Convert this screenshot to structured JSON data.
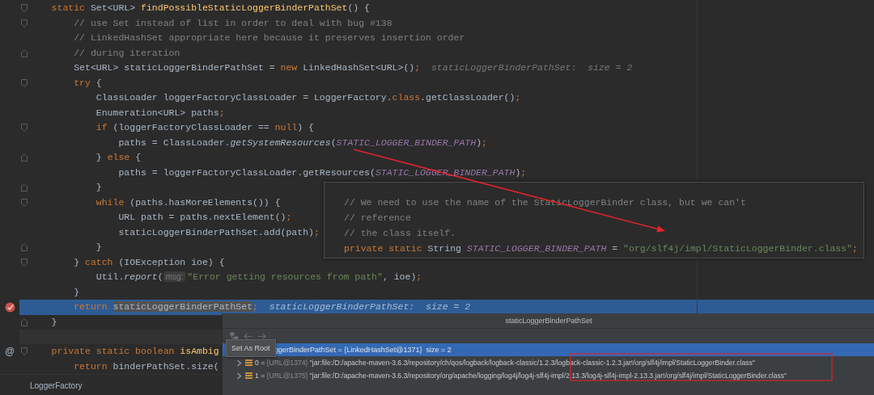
{
  "editor": {
    "lines": [
      {
        "kind": "fold_start",
        "breakpoint": false,
        "current": false,
        "tokens": [
          {
            "kind": "keyword",
            "text": "    static "
          },
          {
            "kind": "plain",
            "text": "Set<URL> "
          },
          {
            "kind": "declaration",
            "text": "findPossibleStaticLoggerBinderPathSet"
          },
          {
            "kind": "plain",
            "text": "() {"
          }
        ]
      },
      {
        "kind": "fold_start",
        "breakpoint": false,
        "current": false,
        "tokens": [
          {
            "kind": "comment",
            "text": "        // use Set instead of list in order to deal with bug #138"
          }
        ]
      },
      {
        "kind": "code",
        "breakpoint": false,
        "current": false,
        "tokens": [
          {
            "kind": "comment",
            "text": "        // LinkedHashSet appropriate here because it preserves insertion order"
          }
        ]
      },
      {
        "kind": "fold_end",
        "breakpoint": false,
        "current": false,
        "tokens": [
          {
            "kind": "comment",
            "text": "        // during iteration"
          }
        ]
      },
      {
        "kind": "code",
        "breakpoint": false,
        "current": false,
        "tokens": [
          {
            "kind": "plain",
            "text": "        Set<URL> staticLoggerBinderPathSet = "
          },
          {
            "kind": "keyword",
            "text": "new"
          },
          {
            "kind": "plain",
            "text": " LinkedHashSet<URL>()"
          },
          {
            "kind": "keyword",
            "text": ";"
          },
          {
            "kind": "hint",
            "text": "  staticLoggerBinderPathSet:  size = 2"
          }
        ]
      },
      {
        "kind": "fold_start",
        "breakpoint": false,
        "current": false,
        "tokens": [
          {
            "kind": "keyword",
            "text": "        try"
          },
          {
            "kind": "plain",
            "text": " {"
          }
        ]
      },
      {
        "kind": "code",
        "breakpoint": false,
        "current": false,
        "tokens": [
          {
            "kind": "plain",
            "text": "            ClassLoader loggerFactoryClassLoader = LoggerFactory."
          },
          {
            "kind": "keyword",
            "text": "class"
          },
          {
            "kind": "plain",
            "text": ".getClassLoader()"
          },
          {
            "kind": "keyword",
            "text": ";"
          }
        ]
      },
      {
        "kind": "code",
        "breakpoint": false,
        "current": false,
        "tokens": [
          {
            "kind": "plain",
            "text": "            Enumeration<URL> paths"
          },
          {
            "kind": "keyword",
            "text": ";"
          }
        ]
      },
      {
        "kind": "fold_start",
        "breakpoint": false,
        "current": false,
        "tokens": [
          {
            "kind": "keyword",
            "text": "            if"
          },
          {
            "kind": "plain",
            "text": " (loggerFactoryClassLoader == "
          },
          {
            "kind": "keyword",
            "text": "null"
          },
          {
            "kind": "plain",
            "text": ") {"
          }
        ]
      },
      {
        "kind": "code",
        "breakpoint": false,
        "current": false,
        "tokens": [
          {
            "kind": "plain",
            "text": "                paths = ClassLoader."
          },
          {
            "kind": "static",
            "text": "getSystemResources"
          },
          {
            "kind": "plain",
            "text": "("
          },
          {
            "kind": "constant",
            "text": "STATIC_LOGGER_BINDER_PATH"
          },
          {
            "kind": "plain",
            "text": ")"
          },
          {
            "kind": "keyword",
            "text": ";"
          }
        ]
      },
      {
        "kind": "fold_end",
        "breakpoint": false,
        "current": false,
        "tokens": [
          {
            "kind": "plain",
            "text": "            } "
          },
          {
            "kind": "keyword",
            "text": "else"
          },
          {
            "kind": "plain",
            "text": " {"
          }
        ]
      },
      {
        "kind": "code",
        "breakpoint": false,
        "current": false,
        "tokens": [
          {
            "kind": "plain",
            "text": "                paths = loggerFactoryClassLoader.getResources("
          },
          {
            "kind": "constant",
            "text": "STATIC_LOGGER_BINDER_PATH"
          },
          {
            "kind": "plain",
            "text": ")"
          },
          {
            "kind": "keyword",
            "text": ";"
          }
        ]
      },
      {
        "kind": "fold_end",
        "breakpoint": false,
        "current": false,
        "tokens": [
          {
            "kind": "plain",
            "text": "            }"
          }
        ]
      },
      {
        "kind": "fold_start",
        "breakpoint": false,
        "current": false,
        "tokens": [
          {
            "kind": "keyword",
            "text": "            while"
          },
          {
            "kind": "plain",
            "text": " (paths.hasMoreElements()) {"
          }
        ]
      },
      {
        "kind": "code",
        "breakpoint": false,
        "current": false,
        "tokens": [
          {
            "kind": "plain",
            "text": "                URL path = paths.nextElement()"
          },
          {
            "kind": "keyword",
            "text": ";"
          }
        ]
      },
      {
        "kind": "code",
        "breakpoint": false,
        "current": false,
        "tokens": [
          {
            "kind": "plain",
            "text": "                staticLoggerBinderPathSet.add(path)"
          },
          {
            "kind": "keyword",
            "text": ";"
          }
        ]
      },
      {
        "kind": "fold_end",
        "breakpoint": false,
        "current": false,
        "tokens": [
          {
            "kind": "plain",
            "text": "            }"
          }
        ]
      },
      {
        "kind": "fold_start",
        "breakpoint": false,
        "current": false,
        "tokens": [
          {
            "kind": "plain",
            "text": "        } "
          },
          {
            "kind": "keyword",
            "text": "catch"
          },
          {
            "kind": "plain",
            "text": " (IOException ioe) {"
          }
        ]
      },
      {
        "kind": "code",
        "breakpoint": false,
        "current": false,
        "tokens": [
          {
            "kind": "plain",
            "text": "            Util."
          },
          {
            "kind": "static",
            "text": "report"
          },
          {
            "kind": "plain",
            "text": "("
          },
          {
            "kind": "param",
            "text": "msg:"
          },
          {
            "kind": "string",
            "text": "\"Error getting resources from path\""
          },
          {
            "kind": "plain",
            "text": ", ioe)"
          },
          {
            "kind": "keyword",
            "text": ";"
          }
        ]
      },
      {
        "kind": "code",
        "breakpoint": false,
        "current": false,
        "tokens": [
          {
            "kind": "plain",
            "text": "        }"
          }
        ]
      },
      {
        "kind": "code",
        "breakpoint": true,
        "current": true,
        "tokens": [
          {
            "kind": "keyword",
            "text": "        return "
          },
          {
            "kind": "selection",
            "text": "staticLoggerBinderPathSet"
          },
          {
            "kind": "keyword",
            "text": ";"
          },
          {
            "kind": "hint",
            "text": "  staticLoggerBinderPathSet:  size = 2"
          }
        ]
      },
      {
        "kind": "fold_end",
        "breakpoint": false,
        "current": false,
        "tokens": [
          {
            "kind": "plain",
            "text": "    }"
          }
        ]
      },
      {
        "kind": "code",
        "breakpoint": false,
        "current": false
      },
      {
        "kind": "fold_start",
        "gutter_text": "@",
        "breakpoint": false,
        "current": false,
        "tokens": [
          {
            "kind": "keyword",
            "text": "    private static boolean "
          },
          {
            "kind": "declaration",
            "text": "isAmbig"
          }
        ]
      },
      {
        "kind": "code",
        "breakpoint": false,
        "current": false,
        "tokens": [
          {
            "kind": "keyword",
            "text": "        return"
          },
          {
            "kind": "plain",
            "text": " binderPathSet.size("
          }
        ]
      }
    ],
    "breadcrumb": "LoggerFactory"
  },
  "doc_popup": {
    "lines": [
      {
        "tokens": [
          {
            "kind": "comment",
            "text": "// We need to use the name of the StaticLoggerBinder class, but we can't"
          }
        ]
      },
      {
        "tokens": [
          {
            "kind": "comment",
            "text": "// reference"
          }
        ]
      },
      {
        "tokens": [
          {
            "kind": "comment",
            "text": "// the class itself."
          }
        ]
      },
      {
        "tokens": [
          {
            "kind": "keyword",
            "text": "private static "
          },
          {
            "kind": "plain",
            "text": "String "
          },
          {
            "kind": "constant",
            "text": "STATIC_LOGGER_BINDER_PATH"
          },
          {
            "kind": "plain",
            "text": " = "
          },
          {
            "kind": "string",
            "text": "\"org/slf4j/impl/StaticLoggerBinder.class\""
          },
          {
            "kind": "keyword",
            "text": ";"
          }
        ]
      }
    ]
  },
  "evaluate_panel": {
    "title": "staticLoggerBinderPathSet",
    "tooltip": "Set As Root",
    "root": {
      "text": "ggerBinderPathSet = {LinkedHashSet@1371}  size = 2",
      "selected": true
    },
    "children": [
      {
        "expanded": false,
        "selected": false,
        "label": "0 = ",
        "ref": "{URL@1374}",
        "value": " \"jar:file:/D:/apache-maven-3.6.3/repository/ch/qos/logback/logback-classic/1.2.3/logback-classic-1.2.3.jar!/org/slf4j/impl/StaticLoggerBinder.class\""
      },
      {
        "expanded": false,
        "selected": false,
        "label": "1 = ",
        "ref": "{URL@1375}",
        "value": " \"jar:file:/D:/apache-maven-3.6.3/repository/org/apache/logging/log4j/log4j-slf4j-impl/2.13.3/log4j-slf4j-impl-2.13.3.jar!/org/slf4j/impl/StaticLoggerBinder.class\""
      }
    ]
  }
}
